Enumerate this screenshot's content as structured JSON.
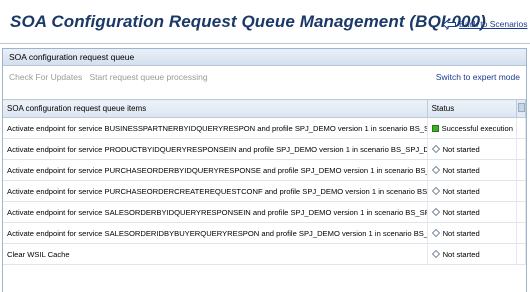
{
  "page": {
    "title": "SOA Configuration Request Queue Management (BQI;000)",
    "back_link": "Back to Scenarios"
  },
  "panel": {
    "title": "SOA configuration request queue",
    "toolbar": {
      "check_updates": "Check For Updates",
      "start_processing": "Start request queue processing",
      "expert_mode": "Switch to expert mode"
    }
  },
  "table": {
    "columns": {
      "items": "SOA configuration request queue items",
      "status": "Status"
    },
    "rows": [
      {
        "item": "Activate endpoint for service BUSINESSPARTNERBYIDQUERYRESPON and profile SPJ_DEMO version 1 in scenario BS_SPJ_DEMO",
        "status": "Successful execution",
        "status_icon": "success-icon"
      },
      {
        "item": "Activate endpoint for service PRODUCTBYIDQUERYRESPONSEIN and profile SPJ_DEMO version 1 in scenario BS_SPJ_DEMO",
        "status": "Not started",
        "status_icon": "diamond-icon"
      },
      {
        "item": "Activate endpoint for service PURCHASEORDERBYIDQUERYRESPONSE and profile SPJ_DEMO version 1 in scenario BS_SPJ_DEMO",
        "status": "Not started",
        "status_icon": "diamond-icon"
      },
      {
        "item": "Activate endpoint for service PURCHASEORDERCREATEREQUESTCONF and profile SPJ_DEMO version 1 in scenario BS_SPJ_DEMO",
        "status": "Not started",
        "status_icon": "diamond-icon"
      },
      {
        "item": "Activate endpoint for service SALESORDERBYIDQUERYRESPONSEIN and profile SPJ_DEMO version 1 in scenario BS_SPJ_DEMO",
        "status": "Not started",
        "status_icon": "diamond-icon"
      },
      {
        "item": "Activate endpoint for service SALESORDERIDBYBUYERQUERYRESPON and profile SPJ_DEMO version 1 in scenario BS_SPJ_DEMO",
        "status": "Not started",
        "status_icon": "diamond-icon"
      },
      {
        "item": "Clear WSIL Cache",
        "status": "Not started",
        "status_icon": "diamond-icon"
      }
    ]
  },
  "colors": {
    "title": "#1a3968",
    "link": "#1a3c8c",
    "success": "#3fae29",
    "disabled": "#9a9a9a"
  }
}
